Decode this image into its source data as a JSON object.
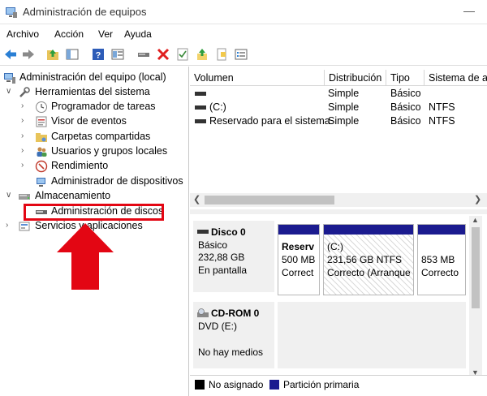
{
  "window": {
    "title": "Administración de equipos",
    "minimize_glyph": "—"
  },
  "menu": [
    "Archivo",
    "Acción",
    "Ver",
    "Ayuda"
  ],
  "toolbar_icons": [
    "back-icon",
    "forward-icon",
    "up-folder-icon",
    "show-hide-tree-icon",
    "help-icon",
    "properties-icon",
    "connect-icon",
    "delete-icon",
    "check-icon",
    "export-icon",
    "refresh-icon",
    "list-icon"
  ],
  "tree": {
    "root": "Administración del equipo (local)",
    "system_tools": "Herramientas del sistema",
    "items": [
      "Programador de tareas",
      "Visor de eventos",
      "Carpetas compartidas",
      "Usuarios y grupos locales",
      "Rendimiento",
      "Administrador de dispositivos"
    ],
    "storage": "Almacenamiento",
    "disk_mgmt": "Administración de discos",
    "services": "Servicios y aplicaciones"
  },
  "volume_list": {
    "headers": [
      "Volumen",
      "Distribución",
      "Tipo",
      "Sistema de a"
    ],
    "rows": [
      {
        "volume": "",
        "layout": "Simple",
        "type": "Básico",
        "fs": ""
      },
      {
        "volume": "(C:)",
        "layout": "Simple",
        "type": "Básico",
        "fs": "NTFS"
      },
      {
        "volume": "Reservado para el sistema",
        "layout": "Simple",
        "type": "Básico",
        "fs": "NTFS"
      }
    ]
  },
  "disks": {
    "disk0": {
      "name": "Disco 0",
      "type": "Básico",
      "size": "232,88 GB",
      "status": "En pantalla",
      "partitions": [
        {
          "name": "Reserv",
          "size": "500 MB",
          "status": "Correct"
        },
        {
          "name": "(C:)",
          "size": "231,56 GB NTFS",
          "status": "Correcto (Arranque"
        },
        {
          "name": "",
          "size": "853 MB",
          "status": "Correcto"
        }
      ]
    },
    "cdrom0": {
      "name": "CD-ROM 0",
      "type": "DVD (E:)",
      "media": "No hay medios"
    }
  },
  "legend": [
    {
      "label": "No asignado",
      "color": "#000000"
    },
    {
      "label": "Partición primaria",
      "color": "#1b1b8f"
    }
  ],
  "colors": {
    "highlight": "#e30613",
    "primary_partition": "#1b1b8f"
  }
}
